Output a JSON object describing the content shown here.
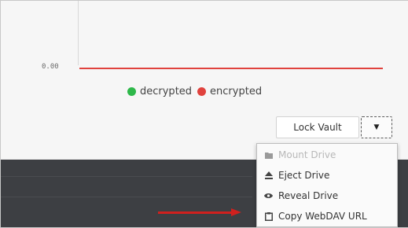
{
  "chart": {
    "y_tick_label": "0.00",
    "legend": [
      {
        "label": "decrypted",
        "color": "#2eb84a"
      },
      {
        "label": "encrypted",
        "color": "#e0423d"
      }
    ]
  },
  "chart_data": {
    "type": "line",
    "series": [
      {
        "name": "decrypted",
        "values": [
          0
        ]
      },
      {
        "name": "encrypted",
        "values": [
          0
        ]
      }
    ],
    "yticks": [
      "0.00"
    ],
    "ylim": [
      0,
      null
    ],
    "legend": "bottom-center"
  },
  "actions": {
    "lock_label": "Lock Vault",
    "toggle_glyph": "▼"
  },
  "menu": {
    "items": [
      {
        "label": "Mount Drive",
        "icon": "folder-icon",
        "enabled": false
      },
      {
        "label": "Eject Drive",
        "icon": "eject-icon",
        "enabled": true
      },
      {
        "label": "Reveal Drive",
        "icon": "eye-icon",
        "enabled": true
      },
      {
        "label": "Copy WebDAV URL",
        "icon": "clipboard-icon",
        "enabled": true
      }
    ]
  },
  "annotation": {
    "color": "#d0201e"
  }
}
